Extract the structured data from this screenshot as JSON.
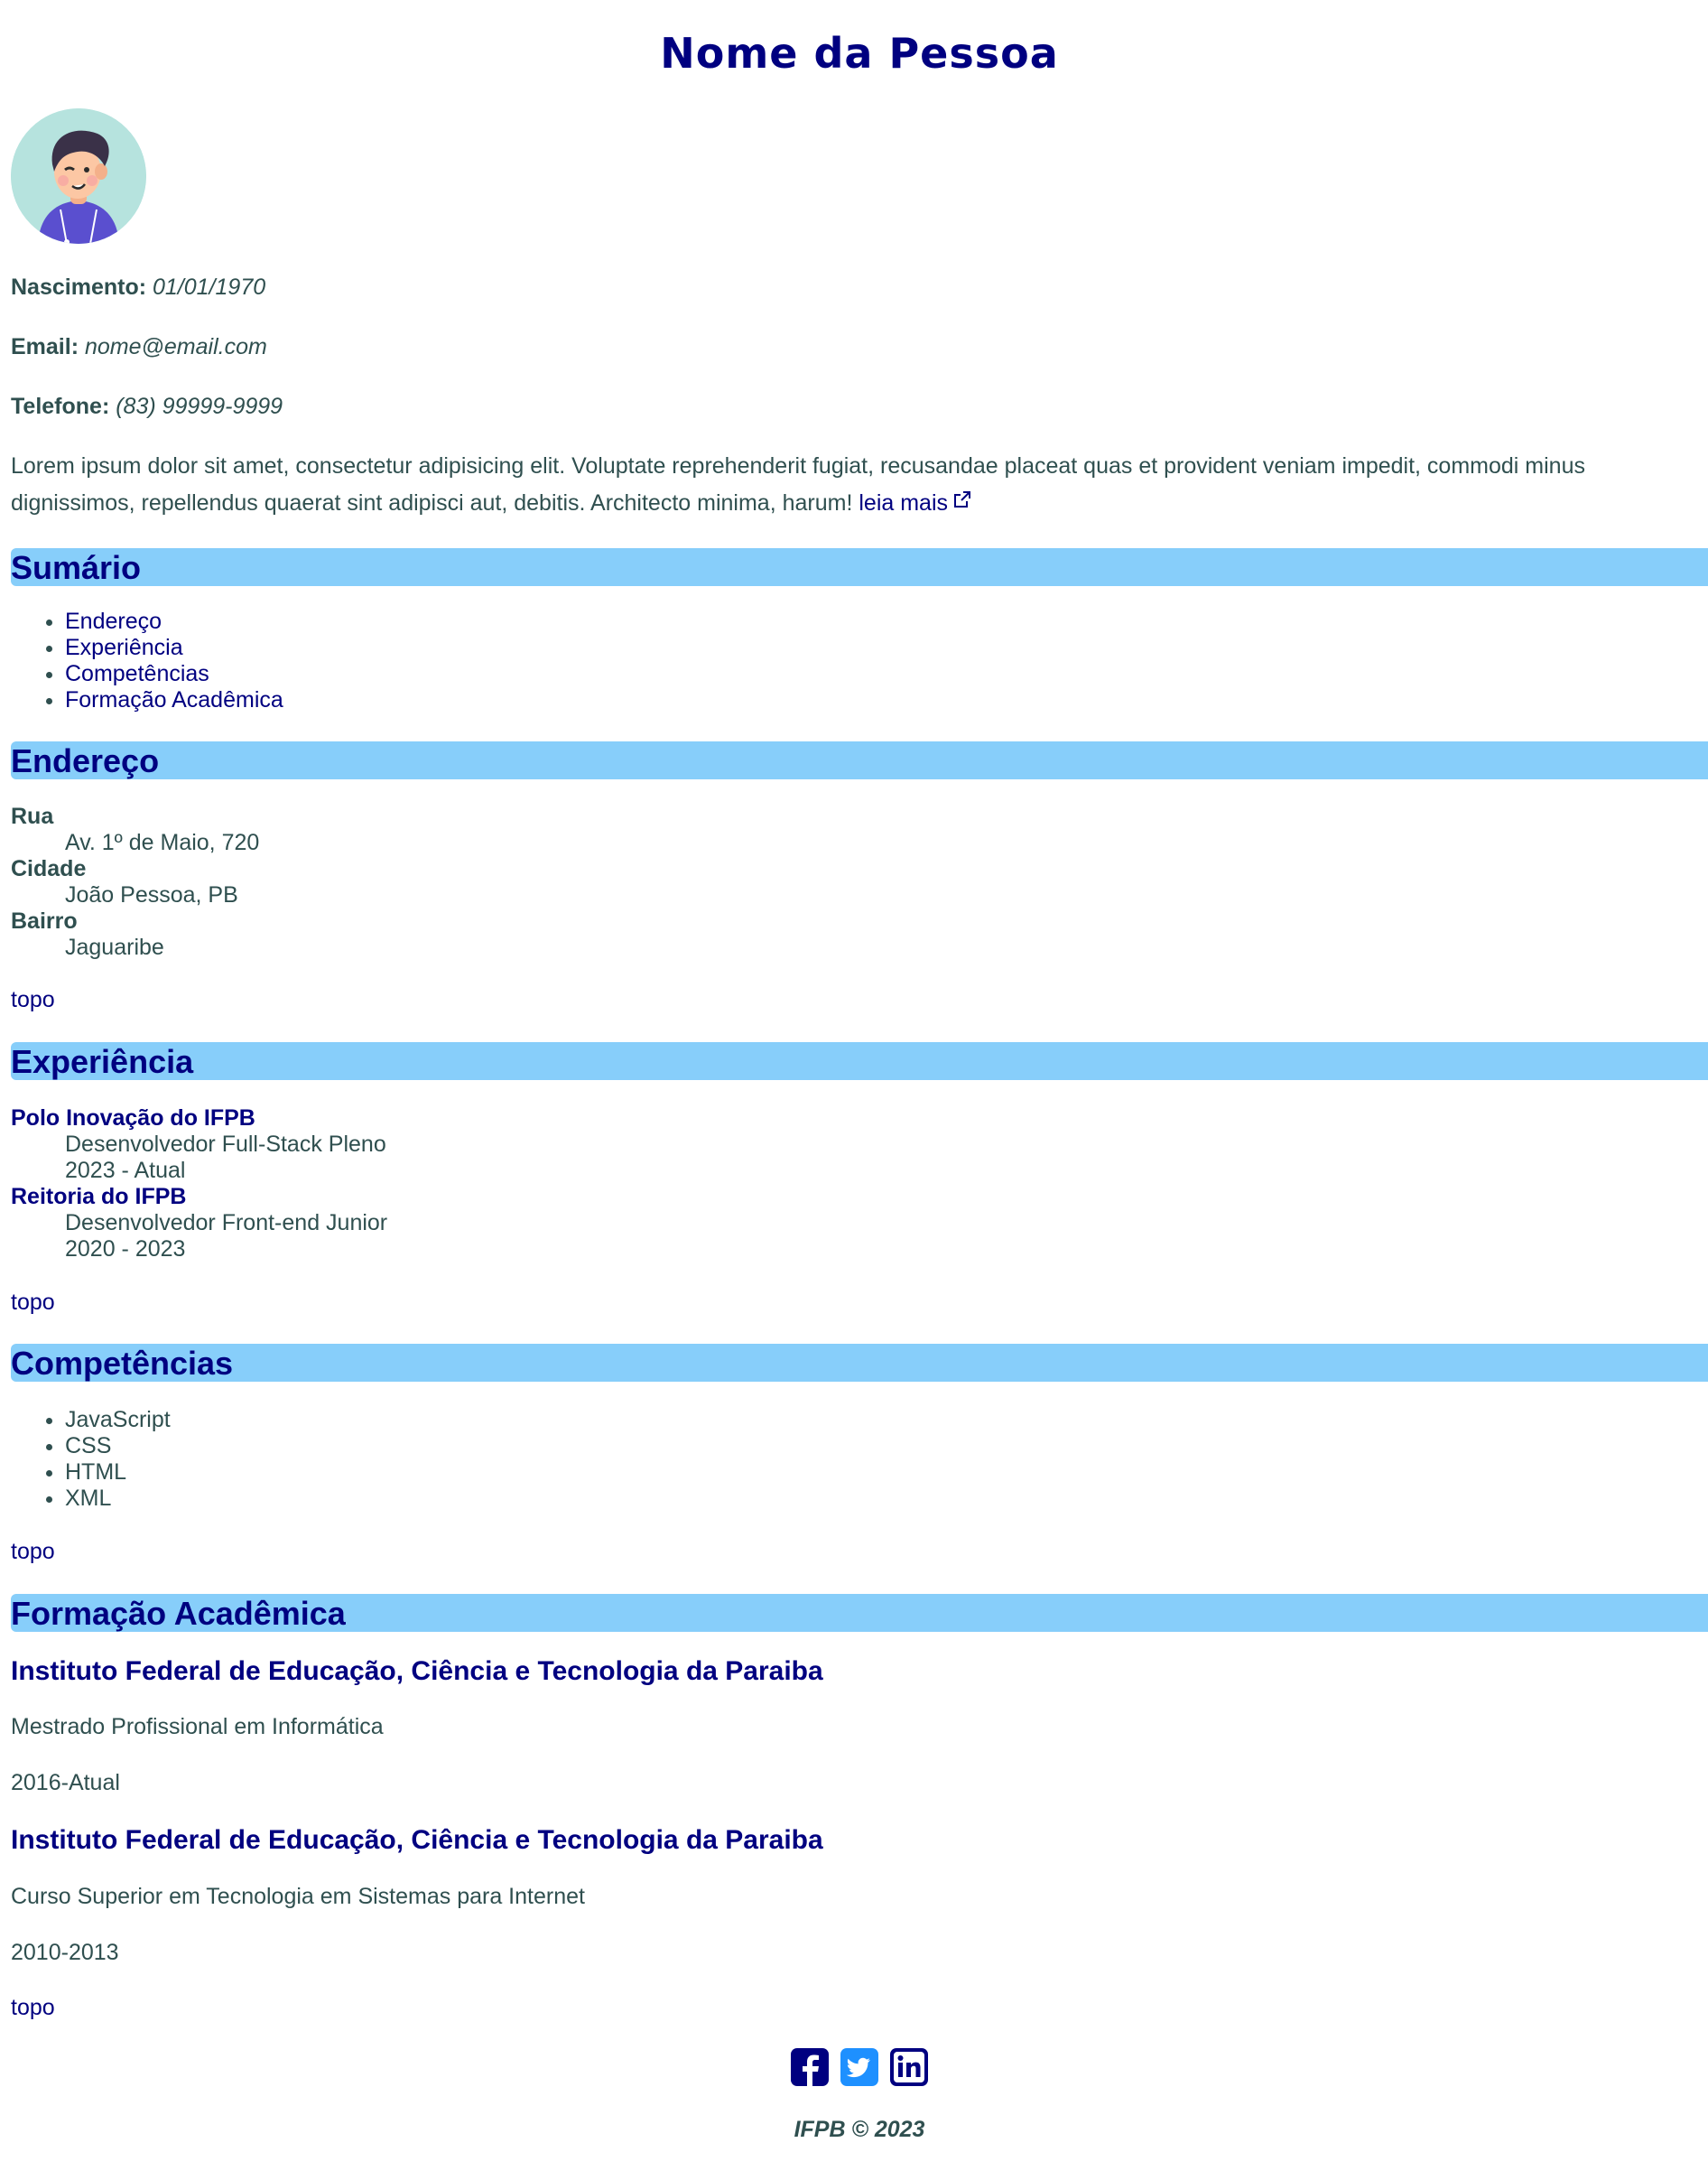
{
  "name": "Nome da Pessoa",
  "info": {
    "birth_label": "Nascimento:",
    "birth_value": "01/01/1970",
    "email_label": "Email:",
    "email_value": "nome@email.com",
    "phone_label": "Telefone:",
    "phone_value": "(83) 99999-9999"
  },
  "intro": {
    "text": "Lorem ipsum dolor sit amet, consectetur adipisicing elit. Voluptate reprehenderit fugiat, recusandae placeat quas et provident veniam impedit, commodi minus dignissimos, repellendus quaerat sint adipisci aut, debitis. Architecto minima, harum!",
    "read_more": "leia mais"
  },
  "summary": {
    "title": "Sumário",
    "items": [
      "Endereço",
      "Experiência",
      "Competências",
      "Formação Acadêmica"
    ]
  },
  "address": {
    "title": "Endereço",
    "street_label": "Rua",
    "street_value": "Av. 1º de Maio, 720",
    "city_label": "Cidade",
    "city_value": "João Pessoa, PB",
    "district_label": "Bairro",
    "district_value": "Jaguaribe"
  },
  "experience": {
    "title": "Experiência",
    "jobs": [
      {
        "company": "Polo Inovação do IFPB",
        "role": "Desenvolvedor Full-Stack Pleno",
        "period": "2023 - Atual"
      },
      {
        "company": "Reitoria do IFPB",
        "role": "Desenvolvedor Front-end Junior",
        "period": "2020 - 2023"
      }
    ]
  },
  "skills": {
    "title": "Competências",
    "items": [
      "JavaScript",
      "CSS",
      "HTML",
      "XML"
    ]
  },
  "education": {
    "title": "Formação Acadêmica",
    "entries": [
      {
        "institution": "Instituto Federal de Educação, Ciência e Tecnologia da Paraiba",
        "course": "Mestrado Profissional em Informática",
        "period": "2016-Atual"
      },
      {
        "institution": "Instituto Federal de Educação, Ciência e Tecnologia da Paraiba",
        "course": "Curso Superior em Tecnologia em Sistemas para Internet",
        "period": "2010-2013"
      }
    ]
  },
  "top_link": "topo",
  "social": {
    "icons": [
      "facebook-icon",
      "twitter-icon",
      "linkedin-icon"
    ],
    "brand_color": "#000080",
    "twitter_color": "#1e90ff"
  },
  "footer": "IFPB © 2023",
  "colors": {
    "heading_bg": "#87cefa",
    "accent": "#000080",
    "text": "#2f4f4f"
  }
}
